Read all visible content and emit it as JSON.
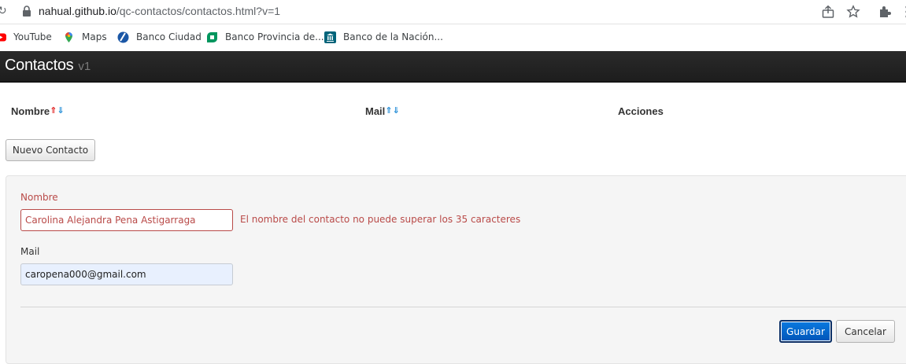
{
  "browser": {
    "url_host": "nahual.github.io",
    "url_path": "/qc-contactos/contactos.html?v=1",
    "bookmarks": [
      {
        "label": "YouTube",
        "icon": "youtube-icon"
      },
      {
        "label": "Maps",
        "icon": "maps-icon"
      },
      {
        "label": "Banco Ciudad",
        "icon": "banco-ciudad-icon"
      },
      {
        "label": "Banco Provincia de...",
        "icon": "banco-provincia-icon"
      },
      {
        "label": "Banco de la Nación...",
        "icon": "banco-nacion-icon"
      }
    ]
  },
  "app": {
    "title": "Contactos",
    "version": "v1"
  },
  "table": {
    "columns": [
      {
        "label": "Nombre",
        "sort": "asc-active"
      },
      {
        "label": "Mail",
        "sort": "none"
      },
      {
        "label": "Acciones"
      }
    ]
  },
  "new_contact_label": "Nuevo Contacto",
  "form": {
    "name_label": "Nombre",
    "name_value": "Carolina Alejandra Pena Astigarraga",
    "name_error": "El nombre del contacto no puede superar los 35 caracteres",
    "mail_label": "Mail",
    "mail_value": "caropena000@gmail.com",
    "save_label": "Guardar",
    "cancel_label": "Cancelar"
  },
  "colors": {
    "navbar": "#222222",
    "error": "#b94a48",
    "primary": "#0063d1",
    "sort_active": "#e02020",
    "sort_inactive": "#1e8ad6"
  }
}
